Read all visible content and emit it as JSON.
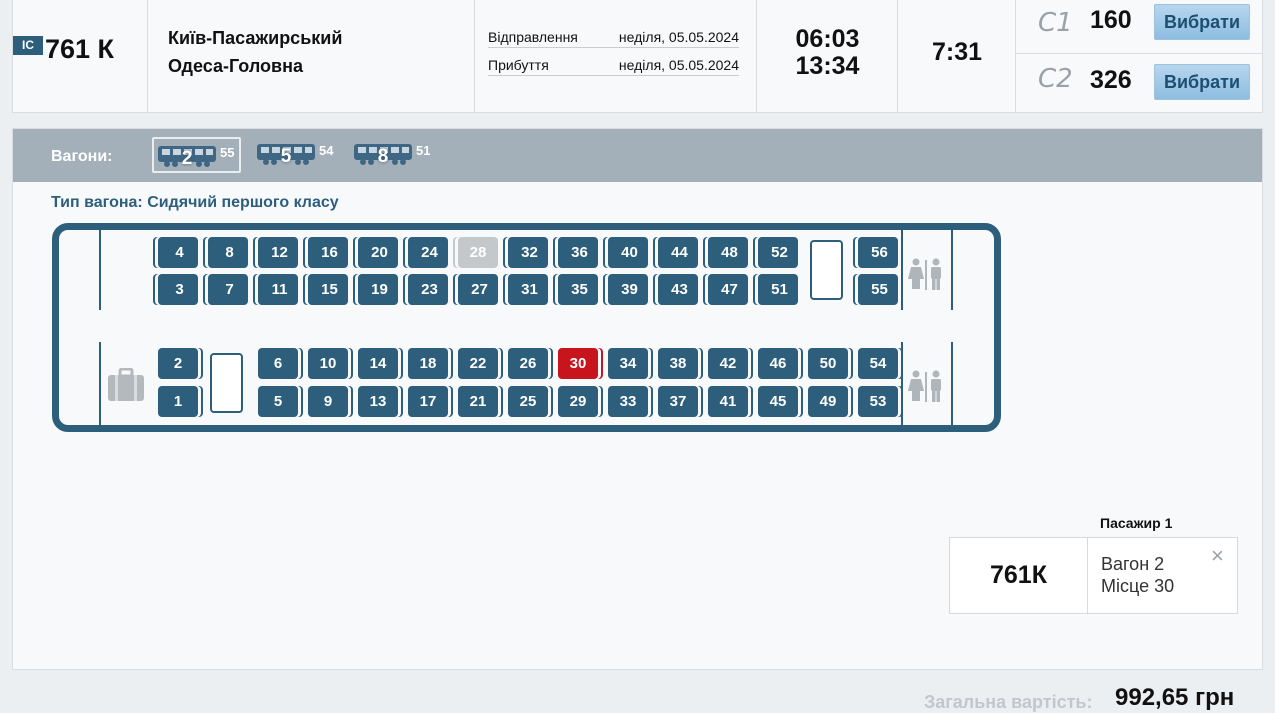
{
  "train": {
    "badge": "IC",
    "number": "761 К",
    "from": "Київ-Пасажирський",
    "to": "Одеса-Головна",
    "departure_label": "Відправлення",
    "departure_date": "неділя, 05.05.2024",
    "arrival_label": "Прибуття",
    "arrival_date": "неділя, 05.05.2024",
    "departure_time": "06:03",
    "arrival_time": "13:34",
    "duration": "7:31",
    "classes": [
      {
        "code": "С1",
        "seats": "160",
        "button": "Вибрати"
      },
      {
        "code": "С2",
        "seats": "326",
        "button": "Вибрати"
      }
    ]
  },
  "wagons": {
    "label": "Вагони:",
    "tabs": [
      {
        "number": "2",
        "free": "55",
        "active": true
      },
      {
        "number": "5",
        "free": "54",
        "active": false
      },
      {
        "number": "8",
        "free": "51",
        "active": false
      }
    ]
  },
  "car": {
    "type_label": "Тип вагона: Сидячий першого класу",
    "upper_top": [
      "4",
      "8",
      "12",
      "16",
      "20",
      "24",
      "28",
      "32",
      "36",
      "40",
      "44",
      "48",
      "52",
      "56"
    ],
    "upper_bottom": [
      "3",
      "7",
      "11",
      "15",
      "19",
      "23",
      "27",
      "31",
      "35",
      "39",
      "43",
      "47",
      "51",
      "55"
    ],
    "lower_top": [
      "2",
      "6",
      "10",
      "14",
      "18",
      "22",
      "26",
      "30",
      "34",
      "38",
      "42",
      "46",
      "50",
      "54"
    ],
    "lower_bottom": [
      "1",
      "5",
      "9",
      "13",
      "17",
      "21",
      "25",
      "29",
      "33",
      "37",
      "41",
      "45",
      "49",
      "53"
    ],
    "taken": [
      "28"
    ],
    "selected": [
      "30"
    ],
    "icons": {
      "toilet": "toilet-icon",
      "luggage": "luggage-icon",
      "close": "close-icon"
    },
    "colors": {
      "seat": "#2d5f7d",
      "taken": "#c5c8cb",
      "selected": "#c8141c"
    }
  },
  "passenger": {
    "title": "Пасажир 1",
    "train": "761К",
    "wagon": "Вагон 2",
    "seat": "Місце 30",
    "close": "×"
  },
  "total": {
    "label": "Загальна вартість:",
    "value": "992,65 грн"
  }
}
